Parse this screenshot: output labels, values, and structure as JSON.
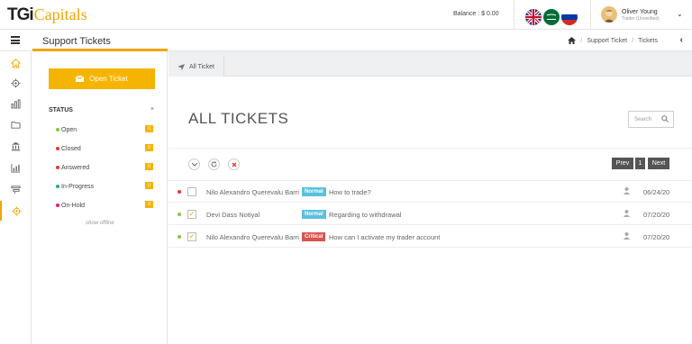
{
  "brand": {
    "logo_part1": "TGi",
    "logo_part2": "Capitals"
  },
  "header": {
    "balance": "Balance : $ 0.00",
    "user_name": "Oliver Young",
    "user_role": "Trader (Unverified)",
    "flags": [
      "uk-flag-icon",
      "saudi-flag-icon",
      "russia-flag-icon"
    ]
  },
  "subheader": {
    "page_title": "Support Tickets",
    "breadcrumbs": [
      "Support Ticket",
      "Tickets"
    ]
  },
  "sidepanel": {
    "open_ticket_label": "Open Ticket",
    "status_title": "STATUS",
    "statuses": [
      {
        "label": "Open",
        "count": "0",
        "color": "#8bc34a"
      },
      {
        "label": "Closed",
        "count": "0",
        "color": "#e53935"
      },
      {
        "label": "Answered",
        "count": "0",
        "color": "#e53935"
      },
      {
        "label": "In-Progress",
        "count": "0",
        "color": "#26a69a"
      },
      {
        "label": "On-Hold",
        "count": "0",
        "color": "#e91e63"
      }
    ],
    "show_offline": "show offline"
  },
  "main": {
    "tab_label": "All Ticket",
    "heading": "ALL TICKETS",
    "search_placeholder": "Search",
    "pager": {
      "prev": "Prev",
      "page": "1",
      "next": "Next"
    },
    "tickets": [
      {
        "name": "Nilo Alexandro Querevalu Barri",
        "priority": "Normal",
        "priority_color": "#5bc0de",
        "subject": "How to trade?",
        "date": "06/24/20",
        "dot_color": "#e53935",
        "checked": false
      },
      {
        "name": "Devi Dass Notiyal",
        "priority": "Normal",
        "priority_color": "#5bc0de",
        "subject": "Regarding to withdrawal",
        "date": "07/20/20",
        "dot_color": "#8bc34a",
        "checked": true
      },
      {
        "name": "Nilo Alexandro Querevalu Barri",
        "priority": "Critical",
        "priority_color": "#d9534f",
        "subject": "How can I activate my trader account",
        "date": "07/20/20",
        "dot_color": "#8bc34a",
        "checked": true
      }
    ]
  },
  "colors": {
    "accent": "#f5b400"
  }
}
